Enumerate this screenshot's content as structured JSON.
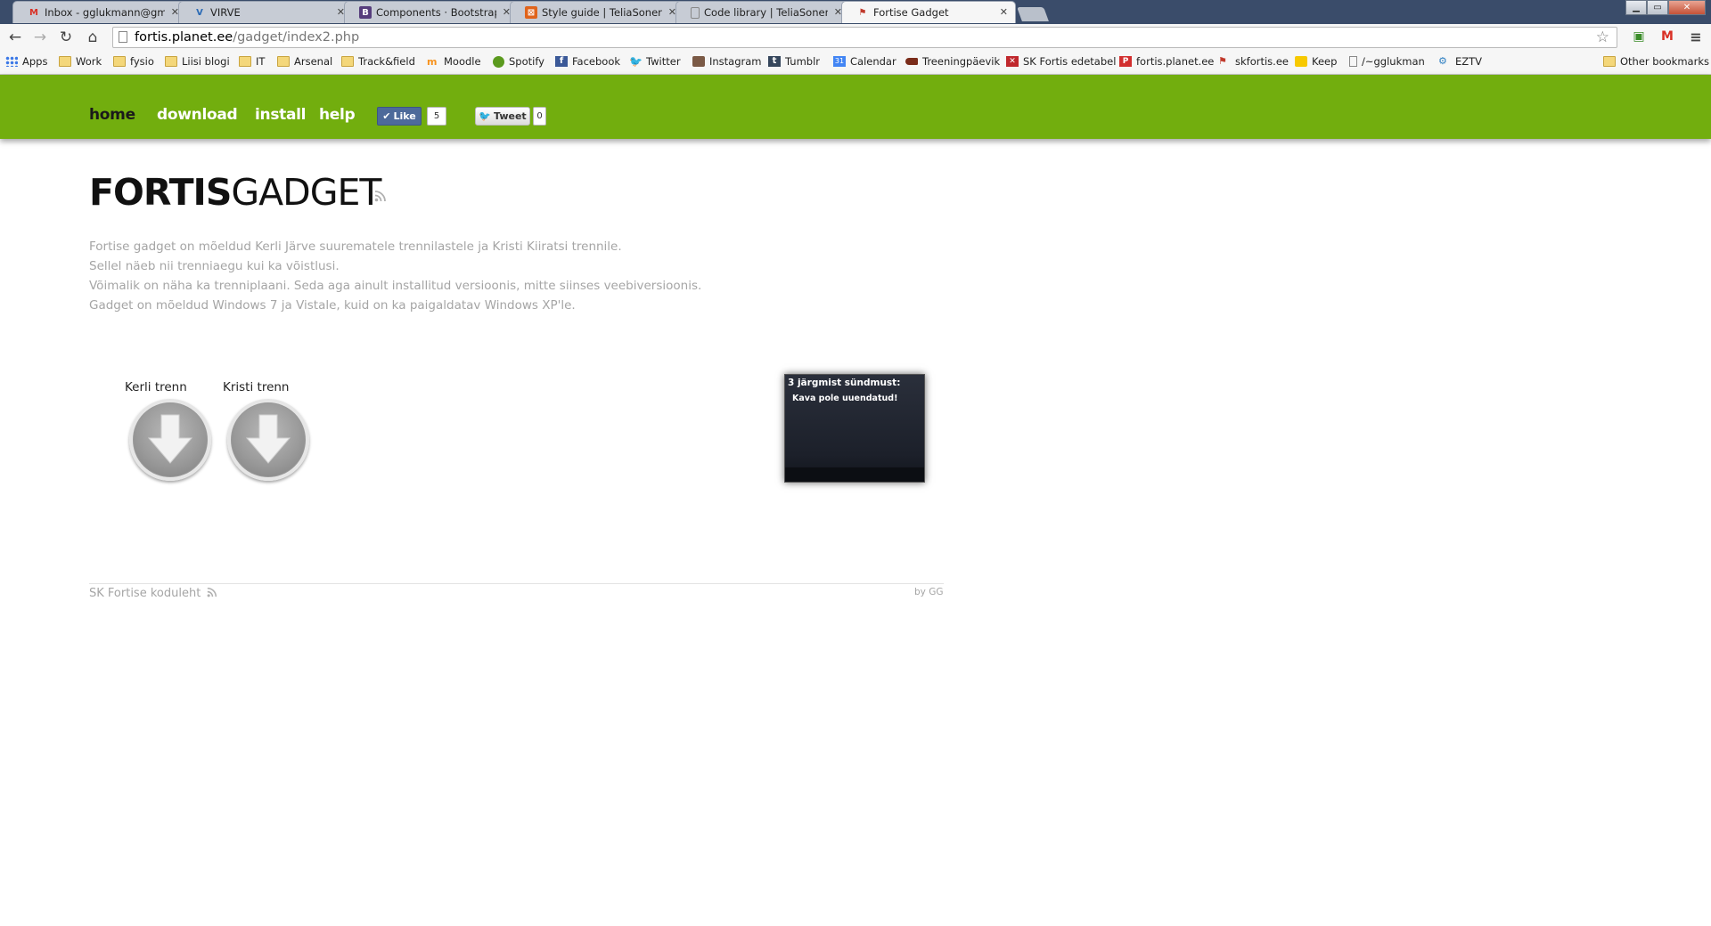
{
  "browser": {
    "tabs": [
      {
        "label": "Inbox - gglukmann@gma",
        "icon": "gmail-icon",
        "icon_color": "#d93025",
        "active": false
      },
      {
        "label": "VIRVE",
        "icon": "virve-icon",
        "icon_color": "#2a6ab5",
        "active": false
      },
      {
        "label": "Components · Bootstrap",
        "icon": "bootstrap-icon",
        "icon_color": "#563d7c",
        "active": false
      },
      {
        "label": "Style guide | TeliaSonera",
        "icon": "teliasonera-icon",
        "icon_color": "#e0641c",
        "active": false
      },
      {
        "label": "Code library | TeliaSonera",
        "icon": "page-icon",
        "icon_color": "#888888",
        "active": false
      },
      {
        "label": "Fortise Gadget",
        "icon": "fortis-icon",
        "icon_color": "#c0392b",
        "active": true
      }
    ],
    "url_domain": "fortis.planet.ee",
    "url_path": "/gadget/index2.php",
    "bookmarks": [
      {
        "label": "Apps",
        "icon": "apps-icon"
      },
      {
        "label": "Work",
        "icon": "folder-icon"
      },
      {
        "label": "fysio",
        "icon": "folder-icon"
      },
      {
        "label": "Liisi blogi",
        "icon": "folder-icon"
      },
      {
        "label": "IT",
        "icon": "folder-icon"
      },
      {
        "label": "Arsenal",
        "icon": "folder-icon"
      },
      {
        "label": "Track&field",
        "icon": "folder-icon"
      },
      {
        "label": "Moodle",
        "icon": "moodle-icon"
      },
      {
        "label": "Spotify",
        "icon": "spotify-icon"
      },
      {
        "label": "Facebook",
        "icon": "facebook-icon"
      },
      {
        "label": "Twitter",
        "icon": "twitter-icon"
      },
      {
        "label": "Instagram",
        "icon": "instagram-icon"
      },
      {
        "label": "Tumblr",
        "icon": "tumblr-icon"
      },
      {
        "label": "Calendar",
        "icon": "calendar-icon"
      },
      {
        "label": "Treeningpäevik",
        "icon": "shoe-icon"
      },
      {
        "label": "SK Fortis edetabel",
        "icon": "fortis-edetabel-icon"
      },
      {
        "label": "fortis.planet.ee",
        "icon": "planet-icon"
      },
      {
        "label": "skfortis.ee",
        "icon": "skfortis-icon"
      },
      {
        "label": "Keep",
        "icon": "keep-icon"
      },
      {
        "label": "/~gglukman",
        "icon": "page-icon"
      },
      {
        "label": "EZTV",
        "icon": "eztv-icon"
      }
    ],
    "other_bookmarks": "Other bookmarks"
  },
  "nav": {
    "home": "home",
    "download": "download",
    "install": "install",
    "help": "help",
    "like_label": "Like",
    "like_count": "5",
    "tweet_label": "Tweet",
    "tweet_count": "0"
  },
  "title": {
    "bold": "FORTIS",
    "light": "GADGET"
  },
  "intro": [
    "Fortise gadget on mõeldud Kerli Järve suurematele trennilastele ja Kristi Kiiratsi trennile.",
    "Sellel näeb nii trenniaegu kui ka võistlusi.",
    "Võimalik on näha ka trenniplaani. Seda aga ainult installitud versioonis, mitte siinses veebiversioonis.",
    "Gadget on mõeldud Windows 7 ja Vistale, kuid on ka paigaldatav Windows XP'le."
  ],
  "downloads": [
    {
      "label": "Kerli trenn"
    },
    {
      "label": "Kristi trenn"
    }
  ],
  "gadget": {
    "title": "3 järgmist sündmust:",
    "message": "Kava pole uuendatud!"
  },
  "footer": {
    "left": "SK Fortise koduleht",
    "right": "by GG"
  },
  "colors": {
    "nav_green": "#72ae0e",
    "intro_gray": "#a5a5a5"
  }
}
